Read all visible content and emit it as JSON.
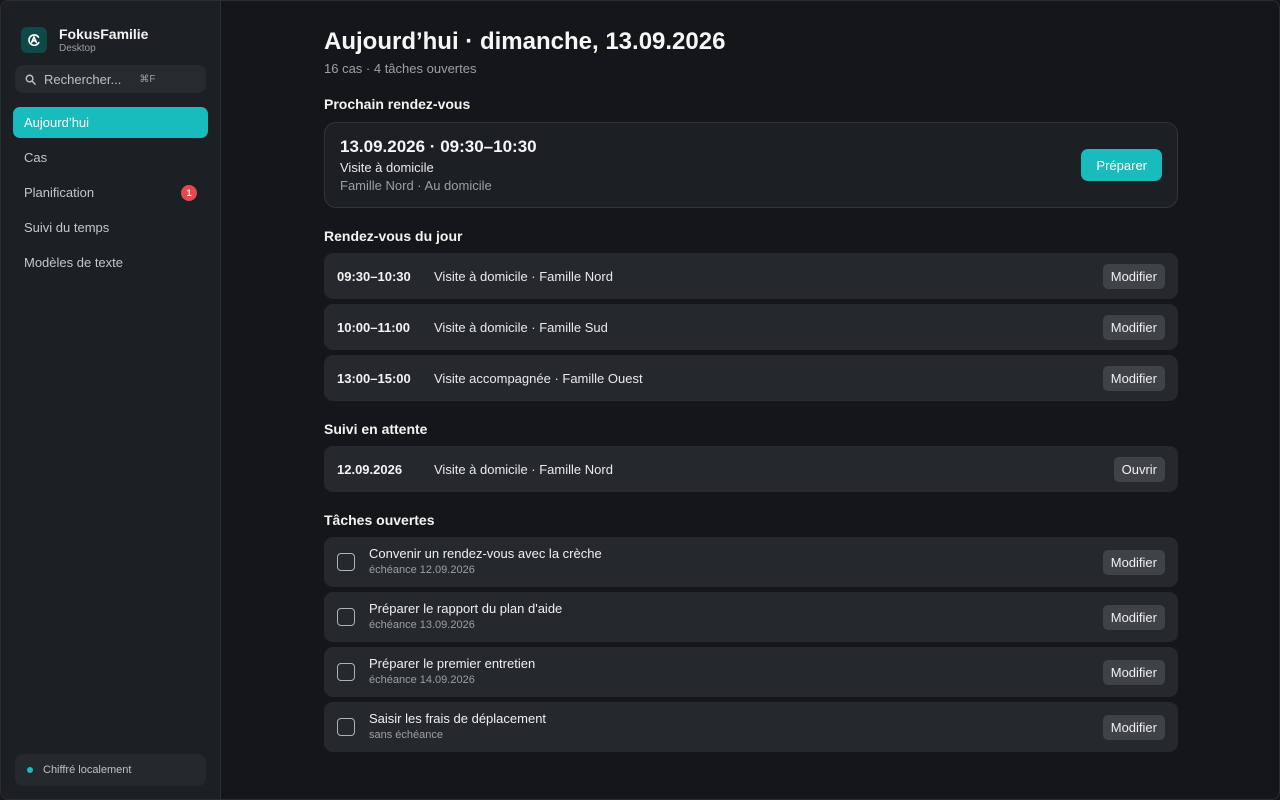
{
  "app": {
    "name": "FokusFamilie",
    "subtitle": "Desktop",
    "accent": "#19bcbc"
  },
  "search": {
    "placeholder": "Rechercher...",
    "shortcut": "⌘F"
  },
  "nav": {
    "items": [
      {
        "label": "Aujourd’hui",
        "active": true
      },
      {
        "label": "Cas"
      },
      {
        "label": "Planification",
        "badge": "1"
      },
      {
        "label": "Suivi du temps"
      },
      {
        "label": "Modèles de texte"
      }
    ]
  },
  "footer": {
    "status": "Chiffré localement"
  },
  "header": {
    "title": "Aujourd’hui · dimanche, 13.09.2026",
    "subtitle": "16 cas · 4 tâches ouvertes"
  },
  "next_appointment": {
    "section_title": "Prochain rendez-vous",
    "time": "13.09.2026 · 09:30–10:30",
    "type": "Visite à domicile",
    "place": "Famille Nord · Au domicile",
    "button": "Préparer"
  },
  "appointments": {
    "section_title": "Rendez-vous du jour",
    "items": [
      {
        "time": "09:30–10:30",
        "desc": "Visite à domicile · Famille Nord",
        "button": "Modifier"
      },
      {
        "time": "10:00–11:00",
        "desc": "Visite à domicile · Famille Sud",
        "button": "Modifier"
      },
      {
        "time": "13:00–15:00",
        "desc": "Visite accompagnée · Famille Ouest",
        "button": "Modifier"
      }
    ]
  },
  "followups": {
    "section_title": "Suivi en attente",
    "items": [
      {
        "date": "12.09.2026",
        "desc": "Visite à domicile · Famille Nord",
        "button": "Ouvrir"
      }
    ]
  },
  "tasks": {
    "section_title": "Tâches ouvertes",
    "items": [
      {
        "title": "Convenir un rendez-vous avec la crèche",
        "due": "échéance 12.09.2026",
        "button": "Modifier"
      },
      {
        "title": "Préparer le rapport du plan d'aide",
        "due": "échéance 13.09.2026",
        "button": "Modifier"
      },
      {
        "title": "Préparer le premier entretien",
        "due": "échéance 14.09.2026",
        "button": "Modifier"
      },
      {
        "title": "Saisir les frais de déplacement",
        "due": "sans échéance",
        "button": "Modifier"
      }
    ]
  }
}
